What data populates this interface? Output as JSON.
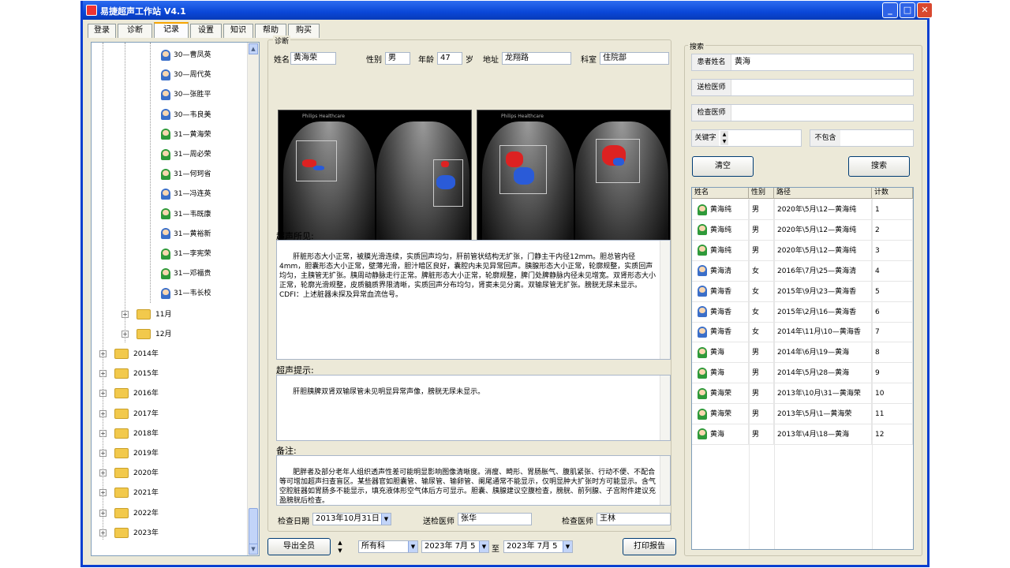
{
  "window": {
    "title": "易捷超声工作站 V4.1"
  },
  "tabs": [
    "登录",
    "诊断",
    "记录",
    "设置",
    "知识",
    "帮助",
    "购买"
  ],
  "active_tab": "记录",
  "tree": {
    "patients": [
      {
        "label": "30—曹凤英",
        "gender": "f"
      },
      {
        "label": "30—周代英",
        "gender": "f"
      },
      {
        "label": "30—张胜平",
        "gender": "f"
      },
      {
        "label": "30—韦良美",
        "gender": "f"
      },
      {
        "label": "31—黄海荣",
        "gender": "m"
      },
      {
        "label": "31—周必荣",
        "gender": "m"
      },
      {
        "label": "31—何珂省",
        "gender": "m"
      },
      {
        "label": "31—冯连英",
        "gender": "f"
      },
      {
        "label": "31—韦既康",
        "gender": "m"
      },
      {
        "label": "31—黄裕新",
        "gender": "f"
      },
      {
        "label": "31—李宪荣",
        "gender": "m"
      },
      {
        "label": "31—邓福贵",
        "gender": "m"
      },
      {
        "label": "31—韦长校",
        "gender": "f"
      }
    ],
    "months": [
      "11月",
      "12月"
    ],
    "years": [
      "2014年",
      "2015年",
      "2016年",
      "2017年",
      "2018年",
      "2019年",
      "2020年",
      "2021年",
      "2022年",
      "2023年"
    ]
  },
  "diagnosis": {
    "group_title": "诊断",
    "name_label": "姓名",
    "name": "黄海荣",
    "gender_label": "性别",
    "gender": "男",
    "age_label": "年龄",
    "age": "47",
    "age_unit": "岁",
    "address_label": "地址",
    "address": "龙翔路",
    "dept_label": "科室",
    "dept": "住院部",
    "image_header": "Philips Healthcare",
    "findings_label": "超声所见:",
    "findings": "肝脏形态大小正常，被膜光滑连续，实质回声均匀，肝前管状结构无扩张，门静主干内径12mm。胆总管内径4mm，胆囊形态大小正常，壁薄光滑，胆汁暗区良好，囊腔内未见异常回声。胰腺形态大小正常，轮廓规整，实质回声均匀，主胰管无扩张。胰周动静脉走行正常。脾脏形态大小正常，轮廓规整，脾门处脾静脉内径未见增宽。双肾形态大小正常，轮廓光滑规整，皮质髓质界限清晰，实质回声分布均匀，肾窦未见分离。双输尿管无扩张。膀胱无尿未显示。CDFI：上述脏器未探及异常血流信号。",
    "hint_label": "超声提示:",
    "hint": "肝胆胰脾双肾双输尿管未见明显异常声像，膀胱无尿未显示。",
    "note_label": "备注:",
    "note": "肥胖者及部分老年人组织透声性差可能明显影响图像清晰度。消瘦、畸形、胃肠胀气、腹肌紧张、行动不便、不配合等可增加超声扫查盲区。某些器官如胆囊管、输尿管、输卵管、阑尾通常不能显示，仅明显肿大扩张时方可能显示。含气空腔脏器如胃肠多不能显示，填充液体形空气体后方可显示。胆囊、胰腺建议空腹检查，膀胱、前列腺、子宫附件建议充盈膀胱后检查。",
    "exam_date_label": "检查日期",
    "exam_date": "2013年10月31日",
    "sender_label": "送检医师",
    "sender": "张华",
    "checker_label": "检查医师",
    "checker": "王林"
  },
  "bottom": {
    "export_label": "导出全员",
    "dept_select": "所有科",
    "date_from": "2023年 7月 5",
    "to_label": "至",
    "date_to": "2023年 7月 5",
    "print_label": "打印报告"
  },
  "search": {
    "group_title": "搜索",
    "patient_label": "患者姓名",
    "patient_value": "黄海",
    "sender_label": "送检医师",
    "sender_value": "",
    "checker_label": "检查医师",
    "checker_value": "",
    "keyword_label": "关键字",
    "keyword_value": "",
    "exclude_label": "不包含",
    "exclude_value": "",
    "clear_label": "清空",
    "search_label": "搜索",
    "columns": [
      "姓名",
      "性别",
      "路径",
      "计数"
    ],
    "rows": [
      {
        "name": "黄海纯",
        "sex": "男",
        "path": "2020年\\5月\\12—黄海纯",
        "count": "1"
      },
      {
        "name": "黄海纯",
        "sex": "男",
        "path": "2020年\\5月\\12—黄海纯",
        "count": "2"
      },
      {
        "name": "黄海纯",
        "sex": "男",
        "path": "2020年\\5月\\12—黄海纯",
        "count": "3"
      },
      {
        "name": "黄海清",
        "sex": "女",
        "path": "2016年\\7月\\25—黄海清",
        "count": "4"
      },
      {
        "name": "黄海香",
        "sex": "女",
        "path": "2015年\\9月\\23—黄海香",
        "count": "5"
      },
      {
        "name": "黄海香",
        "sex": "女",
        "path": "2015年\\2月\\16—黄海香",
        "count": "6"
      },
      {
        "name": "黄海香",
        "sex": "女",
        "path": "2014年\\11月\\10—黄海香",
        "count": "7"
      },
      {
        "name": "黄海",
        "sex": "男",
        "path": "2014年\\6月\\19—黄海",
        "count": "8"
      },
      {
        "name": "黄海",
        "sex": "男",
        "path": "2014年\\5月\\28—黄海",
        "count": "9"
      },
      {
        "name": "黄海荣",
        "sex": "男",
        "path": "2013年\\10月\\31—黄海荣",
        "count": "10"
      },
      {
        "name": "黄海荣",
        "sex": "男",
        "path": "2013年\\5月\\1—黄海荣",
        "count": "11"
      },
      {
        "name": "黄海",
        "sex": "男",
        "path": "2013年\\4月\\18—黄海",
        "count": "12"
      }
    ]
  }
}
